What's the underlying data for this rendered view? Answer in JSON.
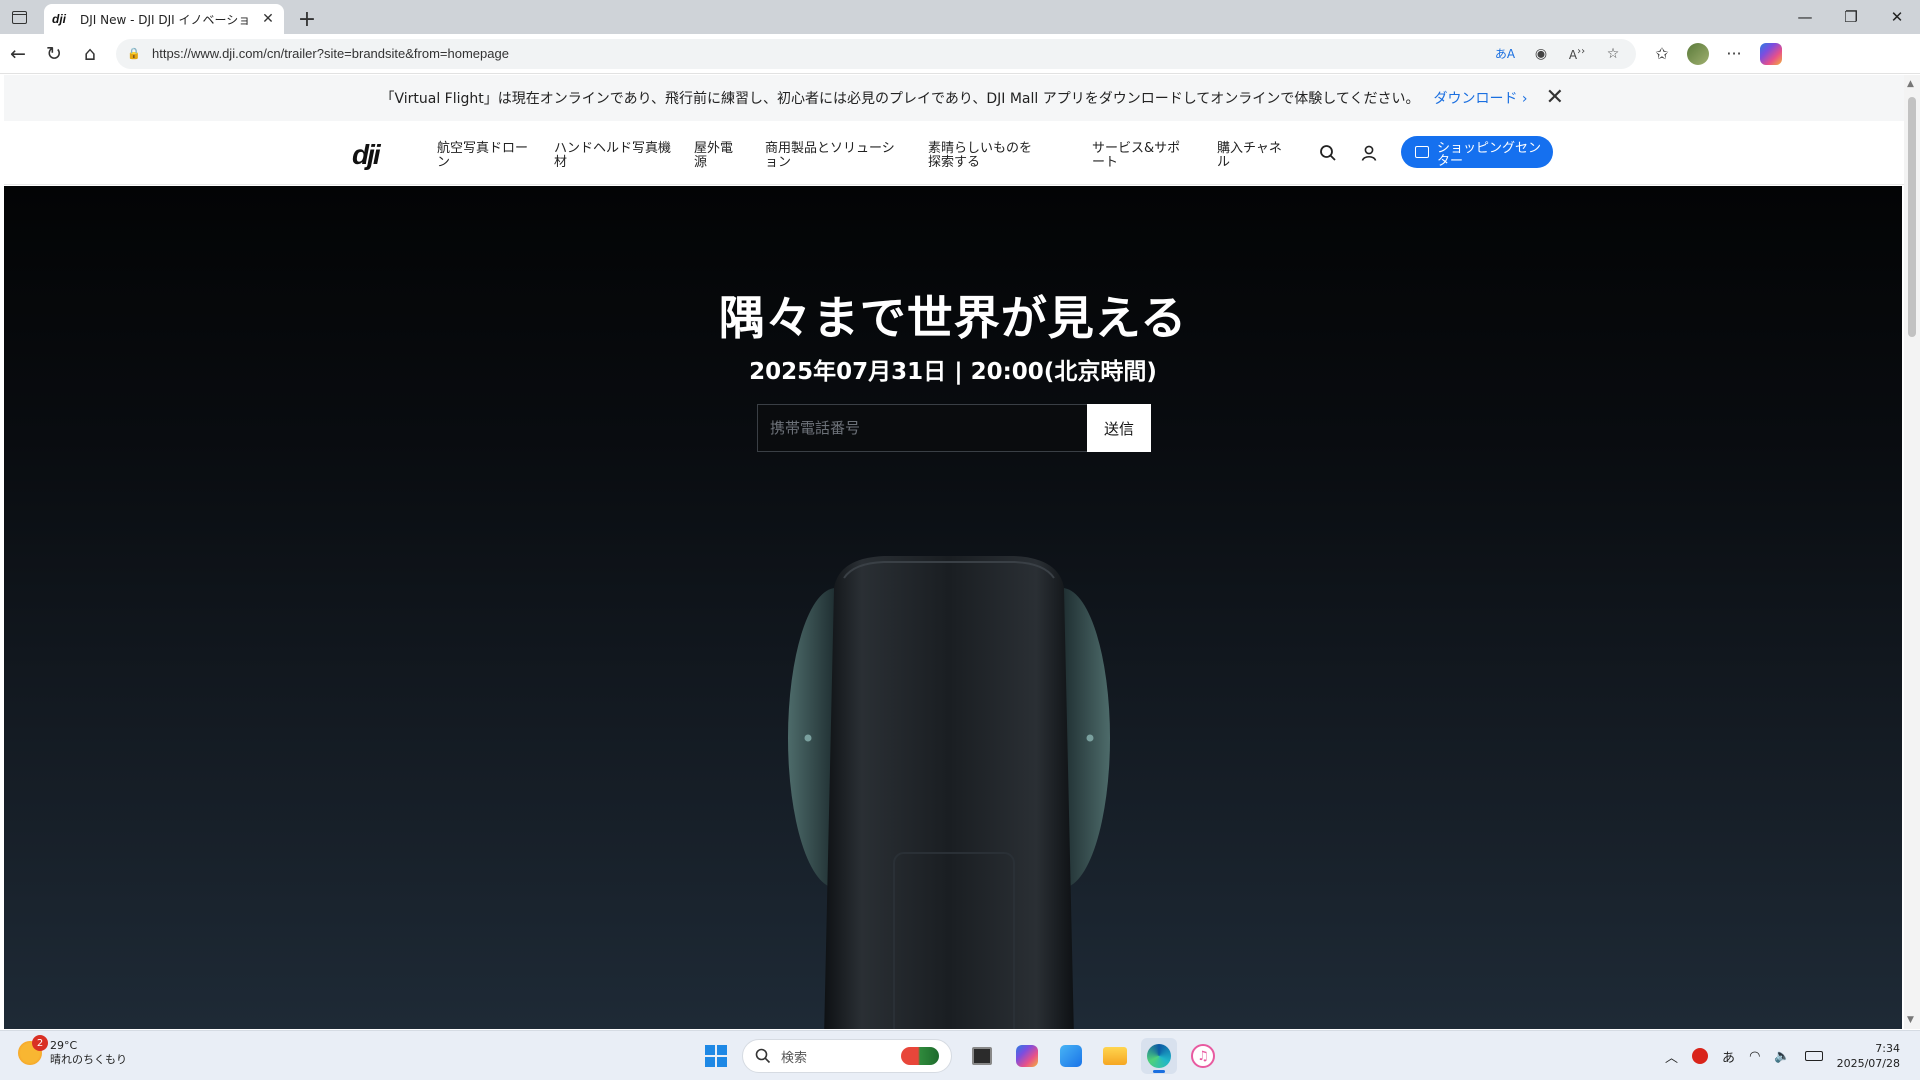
{
  "browser": {
    "tab_title": "DJI New - DJI DJI イノベーション",
    "tab_favicon": "dji",
    "url": "https://www.dji.com/cn/trailer?site=brandsite&from=homepage"
  },
  "notice": {
    "text": "「Virtual Flight」は現在オンラインであり、飛行前に練習し、初心者には必見のプレイであり、DJI Mall アプリをダウンロードしてオンラインで体験してください。",
    "link": "ダウンロード ›"
  },
  "site_nav": {
    "logo": "dji",
    "items": [
      "航空写真ドローン",
      "ハンドヘルド写真機材",
      "屋外電源",
      "商用製品とソリューション",
      "素晴らしいものを探索する",
      "サービス&サポート",
      "購入チャネル"
    ],
    "shop_button": "ショッピングセンター"
  },
  "hero": {
    "title": "隅々まで世界が見える",
    "date": "2025年07月31日 | 20:00(北京時間)",
    "phone_placeholder": "携帯電話番号",
    "submit_label": "送信"
  },
  "taskbar": {
    "weather_temp": "29°C",
    "weather_desc": "晴れのちくもり",
    "weather_badge": "2",
    "search_label": "検索",
    "ime": "あ",
    "time": "7:34",
    "date": "2025/07/28"
  },
  "colors": {
    "accent": "#1570ef",
    "hero_bg_top": "#030405",
    "hero_bg_bottom": "#1e2a36"
  }
}
